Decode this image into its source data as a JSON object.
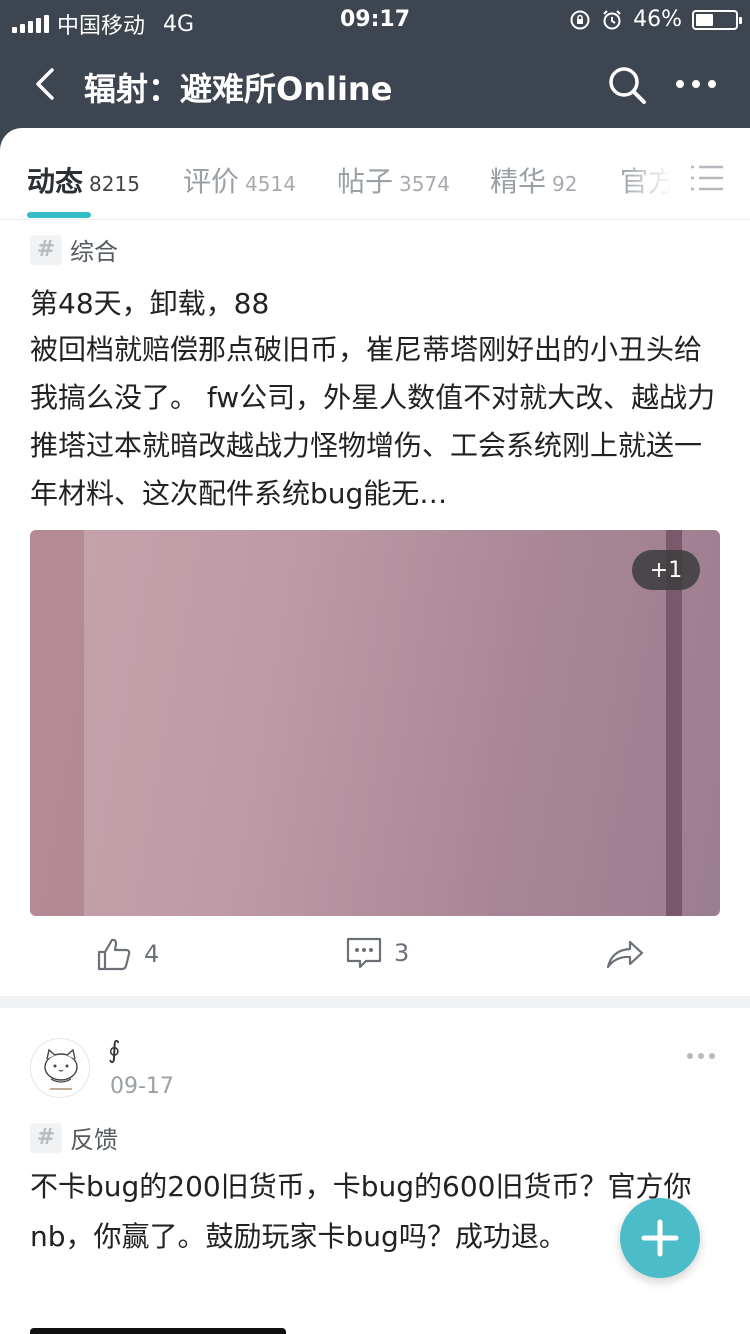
{
  "status_bar": {
    "carrier": "中国移动",
    "network": "4G",
    "time": "09:17",
    "battery": "46%",
    "battery_level": 0.46
  },
  "nav": {
    "title": "辐射：避难所Online"
  },
  "tabs": [
    {
      "label": "动态",
      "count": "8215"
    },
    {
      "label": "评价",
      "count": "4514"
    },
    {
      "label": "帖子",
      "count": "3574"
    },
    {
      "label": "精华",
      "count": "92"
    },
    {
      "label": "官方",
      "count": ""
    }
  ],
  "post1": {
    "tag": "综合",
    "title": "第48天，卸载，88",
    "body": "被回档就赔偿那点破旧币，崔尼蒂塔刚好出的小丑头给我搞么没了。 fw公司，外星人数值不对就大改、越战力推塔过本就暗改越战力怪物增伤、工会系统刚上就送一年材料、这次配件系统bug能无…",
    "image_more": "+1",
    "likes": "4",
    "comments": "3"
  },
  "post2": {
    "username": "∮",
    "date": "09-17",
    "tag": "反馈",
    "body": "不卡bug的200旧货币，卡bug的600旧货币？官方你nb，你赢了。鼓励玩家卡bug吗？成功退。"
  },
  "colors": {
    "nav_bg": "#3c4550",
    "accent": "#35bcc4",
    "fab": "#4bbcc8"
  },
  "icons": [
    "back-arrow-icon",
    "search-icon",
    "more-dots-icon",
    "tab-menu-icon",
    "hash-icon",
    "thumbs-up-icon",
    "comment-icon",
    "share-icon",
    "plus-icon"
  ]
}
